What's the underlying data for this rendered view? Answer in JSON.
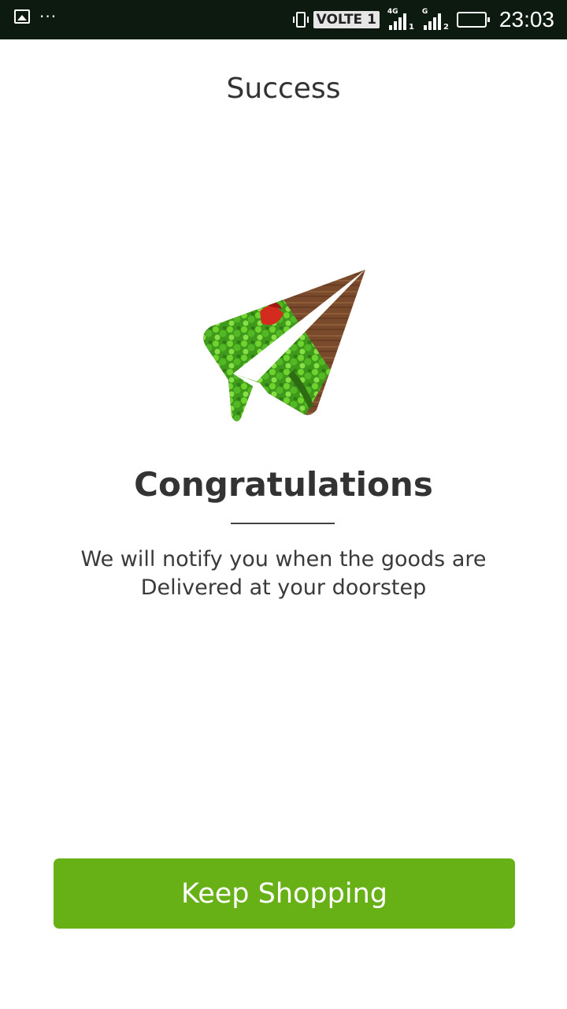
{
  "status_bar": {
    "volte_label": "VOLTE 1",
    "signal1": {
      "network": "4G",
      "sim": "1"
    },
    "signal2": {
      "network": "G",
      "sim": "2"
    },
    "time": "23:03",
    "icons": [
      "gallery-icon",
      "more-dots-icon",
      "vibrate-icon",
      "signal-icon",
      "battery-icon"
    ]
  },
  "page": {
    "title": "Success",
    "illustration_icon": "paper-plane-vegetables-icon",
    "heading": "Congratulations",
    "message_line1": "We will notify you when the goods are",
    "message_line2": "Delivered at your doorstep"
  },
  "actions": {
    "keep_shopping_label": "Keep Shopping"
  },
  "colors": {
    "status_bar_bg": "#0d1a10",
    "accent_green": "#67b117",
    "text_dark": "#333333"
  }
}
